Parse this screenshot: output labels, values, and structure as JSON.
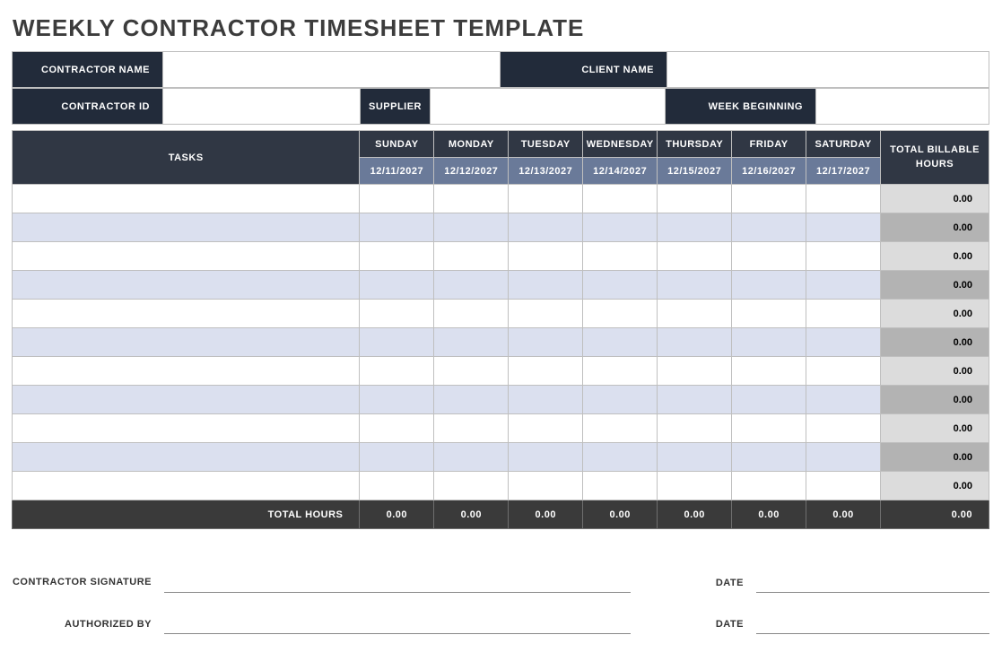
{
  "title": "WEEKLY CONTRACTOR TIMESHEET TEMPLATE",
  "info": {
    "contractor_name_label": "CONTRACTOR NAME",
    "contractor_name_value": "",
    "client_name_label": "CLIENT NAME",
    "client_name_value": "",
    "contractor_id_label": "CONTRACTOR ID",
    "contractor_id_value": "",
    "supplier_label": "SUPPLIER",
    "supplier_value": "",
    "week_begin_label": "WEEK BEGINNING",
    "week_begin_value": ""
  },
  "columns": {
    "tasks": "TASKS",
    "days": [
      "SUNDAY",
      "MONDAY",
      "TUESDAY",
      "WEDNESDAY",
      "THURSDAY",
      "FRIDAY",
      "SATURDAY"
    ],
    "dates": [
      "12/11/2027",
      "12/12/2027",
      "12/13/2027",
      "12/14/2027",
      "12/15/2027",
      "12/16/2027",
      "12/17/2027"
    ],
    "total": "TOTAL BILLABLE HOURS"
  },
  "rows": [
    {
      "task": "",
      "hours": [
        "",
        "",
        "",
        "",
        "",
        "",
        ""
      ],
      "total": "0.00"
    },
    {
      "task": "",
      "hours": [
        "",
        "",
        "",
        "",
        "",
        "",
        ""
      ],
      "total": "0.00"
    },
    {
      "task": "",
      "hours": [
        "",
        "",
        "",
        "",
        "",
        "",
        ""
      ],
      "total": "0.00"
    },
    {
      "task": "",
      "hours": [
        "",
        "",
        "",
        "",
        "",
        "",
        ""
      ],
      "total": "0.00"
    },
    {
      "task": "",
      "hours": [
        "",
        "",
        "",
        "",
        "",
        "",
        ""
      ],
      "total": "0.00"
    },
    {
      "task": "",
      "hours": [
        "",
        "",
        "",
        "",
        "",
        "",
        ""
      ],
      "total": "0.00"
    },
    {
      "task": "",
      "hours": [
        "",
        "",
        "",
        "",
        "",
        "",
        ""
      ],
      "total": "0.00"
    },
    {
      "task": "",
      "hours": [
        "",
        "",
        "",
        "",
        "",
        "",
        ""
      ],
      "total": "0.00"
    },
    {
      "task": "",
      "hours": [
        "",
        "",
        "",
        "",
        "",
        "",
        ""
      ],
      "total": "0.00"
    },
    {
      "task": "",
      "hours": [
        "",
        "",
        "",
        "",
        "",
        "",
        ""
      ],
      "total": "0.00"
    },
    {
      "task": "",
      "hours": [
        "",
        "",
        "",
        "",
        "",
        "",
        ""
      ],
      "total": "0.00"
    }
  ],
  "footer": {
    "label": "TOTAL HOURS",
    "values": [
      "0.00",
      "0.00",
      "0.00",
      "0.00",
      "0.00",
      "0.00",
      "0.00"
    ],
    "grand": "0.00"
  },
  "sign": {
    "contractor_sig": "CONTRACTOR SIGNATURE",
    "authorized_by": "AUTHORIZED BY",
    "date": "DATE"
  }
}
